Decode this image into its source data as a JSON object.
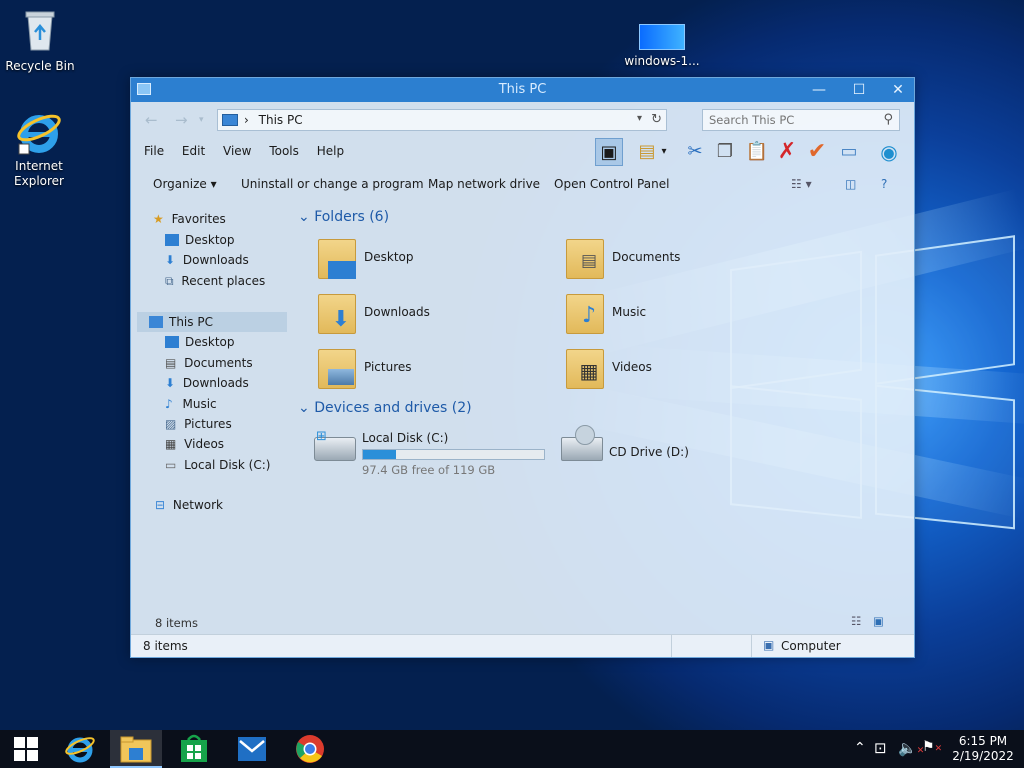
{
  "desktop": {
    "icons": [
      {
        "label": "Recycle Bin"
      },
      {
        "label": "Internet Explorer"
      },
      {
        "label": "windows-1..."
      }
    ]
  },
  "window": {
    "title": "This PC",
    "controls": {
      "minimize": "—",
      "maximize": "☐",
      "close": "✕"
    },
    "address": {
      "path": "This PC",
      "separator": "›"
    },
    "search": {
      "placeholder": "Search This PC"
    },
    "menu": [
      "File",
      "Edit",
      "View",
      "Tools",
      "Help"
    ],
    "commands": [
      "Organize",
      "Uninstall or change a program",
      "Map network drive",
      "Open Control Panel"
    ],
    "toolbar_icons": [
      "layout-icon",
      "folder-options-icon",
      "cut-icon",
      "copy-icon",
      "paste-icon",
      "delete-icon",
      "checkmark-icon",
      "properties-icon",
      "network-globe-icon"
    ],
    "nav": {
      "favorites_label": "Favorites",
      "favorites": [
        "Desktop",
        "Downloads",
        "Recent places"
      ],
      "this_pc_label": "This PC",
      "this_pc_items": [
        "Desktop",
        "Documents",
        "Downloads",
        "Music",
        "Pictures",
        "Videos",
        "Local Disk (C:)"
      ],
      "network_label": "Network"
    },
    "folders_header": "Folders (6)",
    "folders": [
      "Desktop",
      "Documents",
      "Downloads",
      "Music",
      "Pictures",
      "Videos"
    ],
    "drives_header": "Devices and drives (2)",
    "drives": [
      {
        "name": "Local Disk (C:)",
        "free_text": "97.4 GB free of 119 GB",
        "used_fraction": 0.18
      },
      {
        "name": "CD Drive (D:)"
      }
    ],
    "status_items_top": "8 items",
    "status_items_bottom": "8 items",
    "status_location": "Computer"
  },
  "taskbar": {
    "time": "6:15 PM",
    "date": "2/19/2022",
    "pinned": [
      "start-button",
      "internet-explorer",
      "file-explorer",
      "store",
      "mail",
      "chrome"
    ]
  },
  "colors": {
    "titlebar": "#2c7fd0",
    "accent": "#1e5aa8",
    "taskbar": "#0a0f1a"
  }
}
